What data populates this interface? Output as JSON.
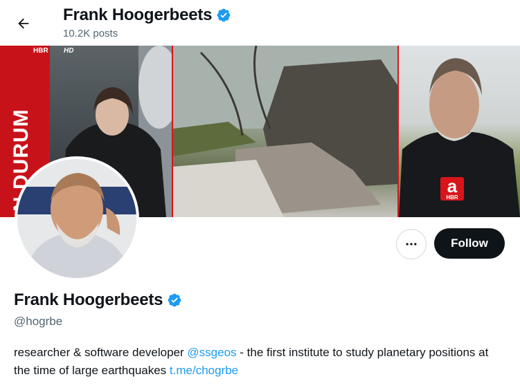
{
  "header": {
    "title": "Frank Hoogerbeets",
    "posts_count": "10.2K posts",
    "back_icon": "arrow-left-icon"
  },
  "banner": {
    "left_panel": {
      "channel_top": "HBR",
      "quality": "HD",
      "side_text": "N DURUM"
    },
    "right_panel": {
      "logo_letter": "a",
      "logo_sub": "HBR"
    },
    "accent_color": "#d8141b"
  },
  "profile": {
    "display_name": "Frank Hoogerbeets",
    "handle": "@hogrbe",
    "verified_icon": "verified-badge-icon",
    "verified_color": "#1d9bf0"
  },
  "actions": {
    "more_icon": "more-horizontal-icon",
    "follow_label": "Follow"
  },
  "bio": {
    "text_1": "researcher & software developer ",
    "mention": "@ssgeos",
    "text_2": " - the first institute to study planetary positions at the time of large earthquakes ",
    "link": "t.me/chogrbe"
  }
}
